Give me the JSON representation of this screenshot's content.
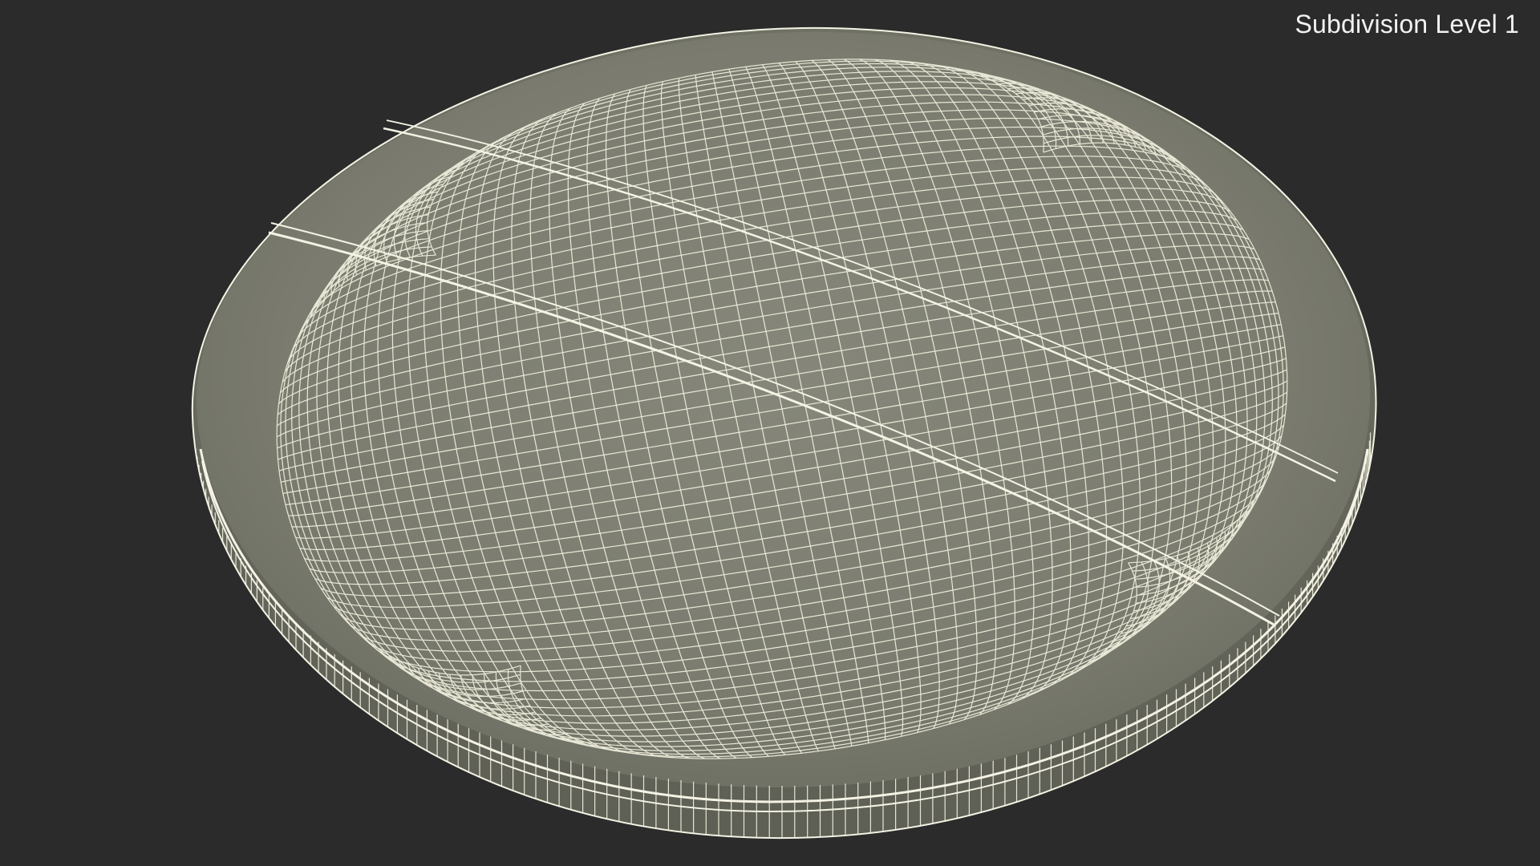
{
  "viewport": {
    "label": "Subdivision Level 1"
  },
  "colors": {
    "background": "#2b2b2b",
    "surface": "#7d7e70",
    "wire": "#efeedc"
  },
  "subject": {
    "icon": "wireframe-cushion"
  }
}
